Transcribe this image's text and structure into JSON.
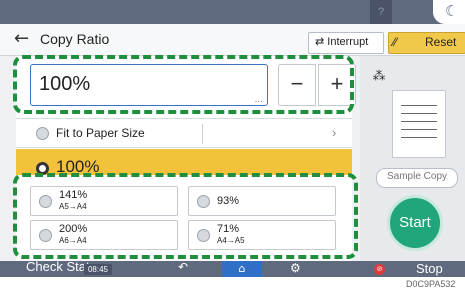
{
  "header": {
    "help_icon": "?",
    "title": "Copy Ratio",
    "interrupt_label": "Interrupt",
    "reset_label": "Reset"
  },
  "ratio_input": {
    "value": "100%",
    "more_indicator": "...",
    "minus_label": "−",
    "plus_label": "+"
  },
  "fit_option": {
    "label": "Fit to Paper Size"
  },
  "selected_option": {
    "label": "100%"
  },
  "presets": [
    {
      "value": "141%",
      "sub": "A5→A4"
    },
    {
      "value": "93%",
      "sub": ""
    },
    {
      "value": "200%",
      "sub": "A6→A4"
    },
    {
      "value": "71%",
      "sub": "A4→A5"
    }
  ],
  "right_panel": {
    "sample_copy_label": "Sample Copy",
    "start_label": "Start"
  },
  "bottom_bar": {
    "check_status_label": "Check Status",
    "time": "08:45",
    "stop_label": "Stop"
  },
  "caption": "D0C9PA532",
  "colors": {
    "highlight": "#1f8f3e",
    "accent": "#f3c23c",
    "start": "#20a67a",
    "home": "#2f6fc6"
  }
}
